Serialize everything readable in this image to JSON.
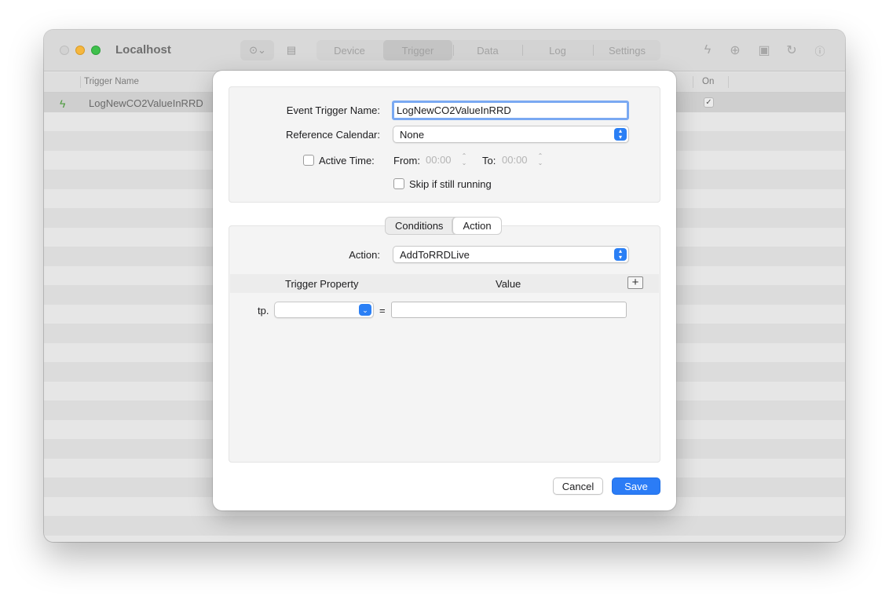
{
  "window": {
    "title": "Localhost",
    "segments": [
      "Device",
      "Trigger",
      "Data",
      "Log",
      "Settings"
    ],
    "selected_segment": "Trigger"
  },
  "table": {
    "columns": {
      "trigger_name": "Trigger Name",
      "on": "On"
    },
    "rows": [
      {
        "name": "LogNewCO2ValueInRRD",
        "on": true
      }
    ]
  },
  "sheet": {
    "event_trigger_name_label": "Event Trigger Name:",
    "event_trigger_name_value": "LogNewCO2ValueInRRD",
    "reference_calendar_label": "Reference Calendar:",
    "reference_calendar_value": "None",
    "active_time_label": "Active Time:",
    "active_time_checked": false,
    "from_label": "From:",
    "from_value": "00:00",
    "to_label": "To:",
    "to_value": "00:00",
    "skip_label": "Skip if still running",
    "skip_checked": false,
    "tabs": [
      "Conditions",
      "Action"
    ],
    "selected_tab": "Action",
    "action_label": "Action:",
    "action_value": "AddToRRDLive",
    "property_table": {
      "col_trigger_property": "Trigger Property",
      "col_value": "Value",
      "add_symbol": "+",
      "prefix": "tp.",
      "equals": "=",
      "property_value": "",
      "value": ""
    },
    "cancel_label": "Cancel",
    "save_label": "Save"
  },
  "colors": {
    "accent": "#2b7cf6",
    "trigger_icon": "#4b9a3c"
  }
}
